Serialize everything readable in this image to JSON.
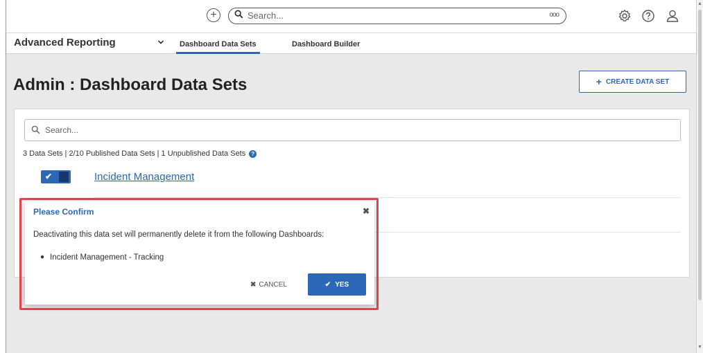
{
  "header": {
    "search_placeholder": "Search...",
    "more_dots": "ooo"
  },
  "nav": {
    "app_name": "Advanced Reporting",
    "tabs": [
      {
        "label": "Dashboard Data Sets",
        "active": true
      },
      {
        "label": "Dashboard Builder",
        "active": false
      }
    ]
  },
  "page": {
    "title": "Admin : Dashboard Data Sets",
    "create_button": "CREATE DATA SET"
  },
  "list": {
    "search_placeholder": "Search...",
    "stats": "3 Data Sets  |  2/10 Published Data Sets  |  1 Unpublished Data Sets",
    "rows": [
      {
        "name": "Incident Management",
        "active": true
      }
    ]
  },
  "dialog": {
    "title": "Please Confirm",
    "message": "Deactivating this data set will permanently delete it from the following Dashboards:",
    "items": [
      "Incident Management - Tracking"
    ],
    "cancel_label": "CANCEL",
    "yes_label": "YES"
  },
  "colors": {
    "accent": "#2d67b8",
    "highlight": "#e0474c",
    "background": "#e9e9e9"
  }
}
